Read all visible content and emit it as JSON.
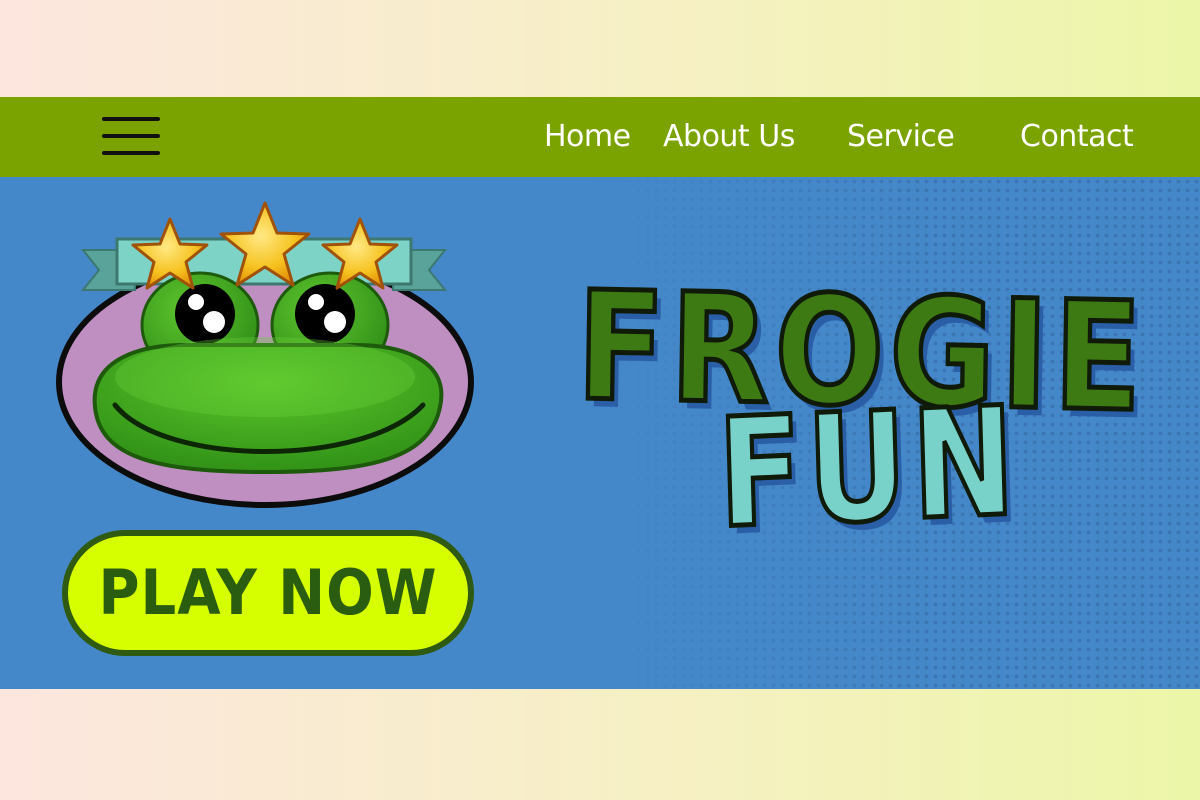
{
  "nav": {
    "menu_icon": "hamburger-menu-icon",
    "items": [
      "Home",
      "About Us",
      "Service",
      "Contact"
    ]
  },
  "hero": {
    "title_line1": "FROGIE",
    "title_line2": "FUN",
    "play_button": "PLAY NOW",
    "rating_stars": 3,
    "logo_icon": "frog-face-icon"
  },
  "colors": {
    "navbar": "#7aa300",
    "hero_background": "#4588c9",
    "play_button": "#d6ff00",
    "title_green": "#3d7a14",
    "title_teal": "#78d2c9"
  }
}
